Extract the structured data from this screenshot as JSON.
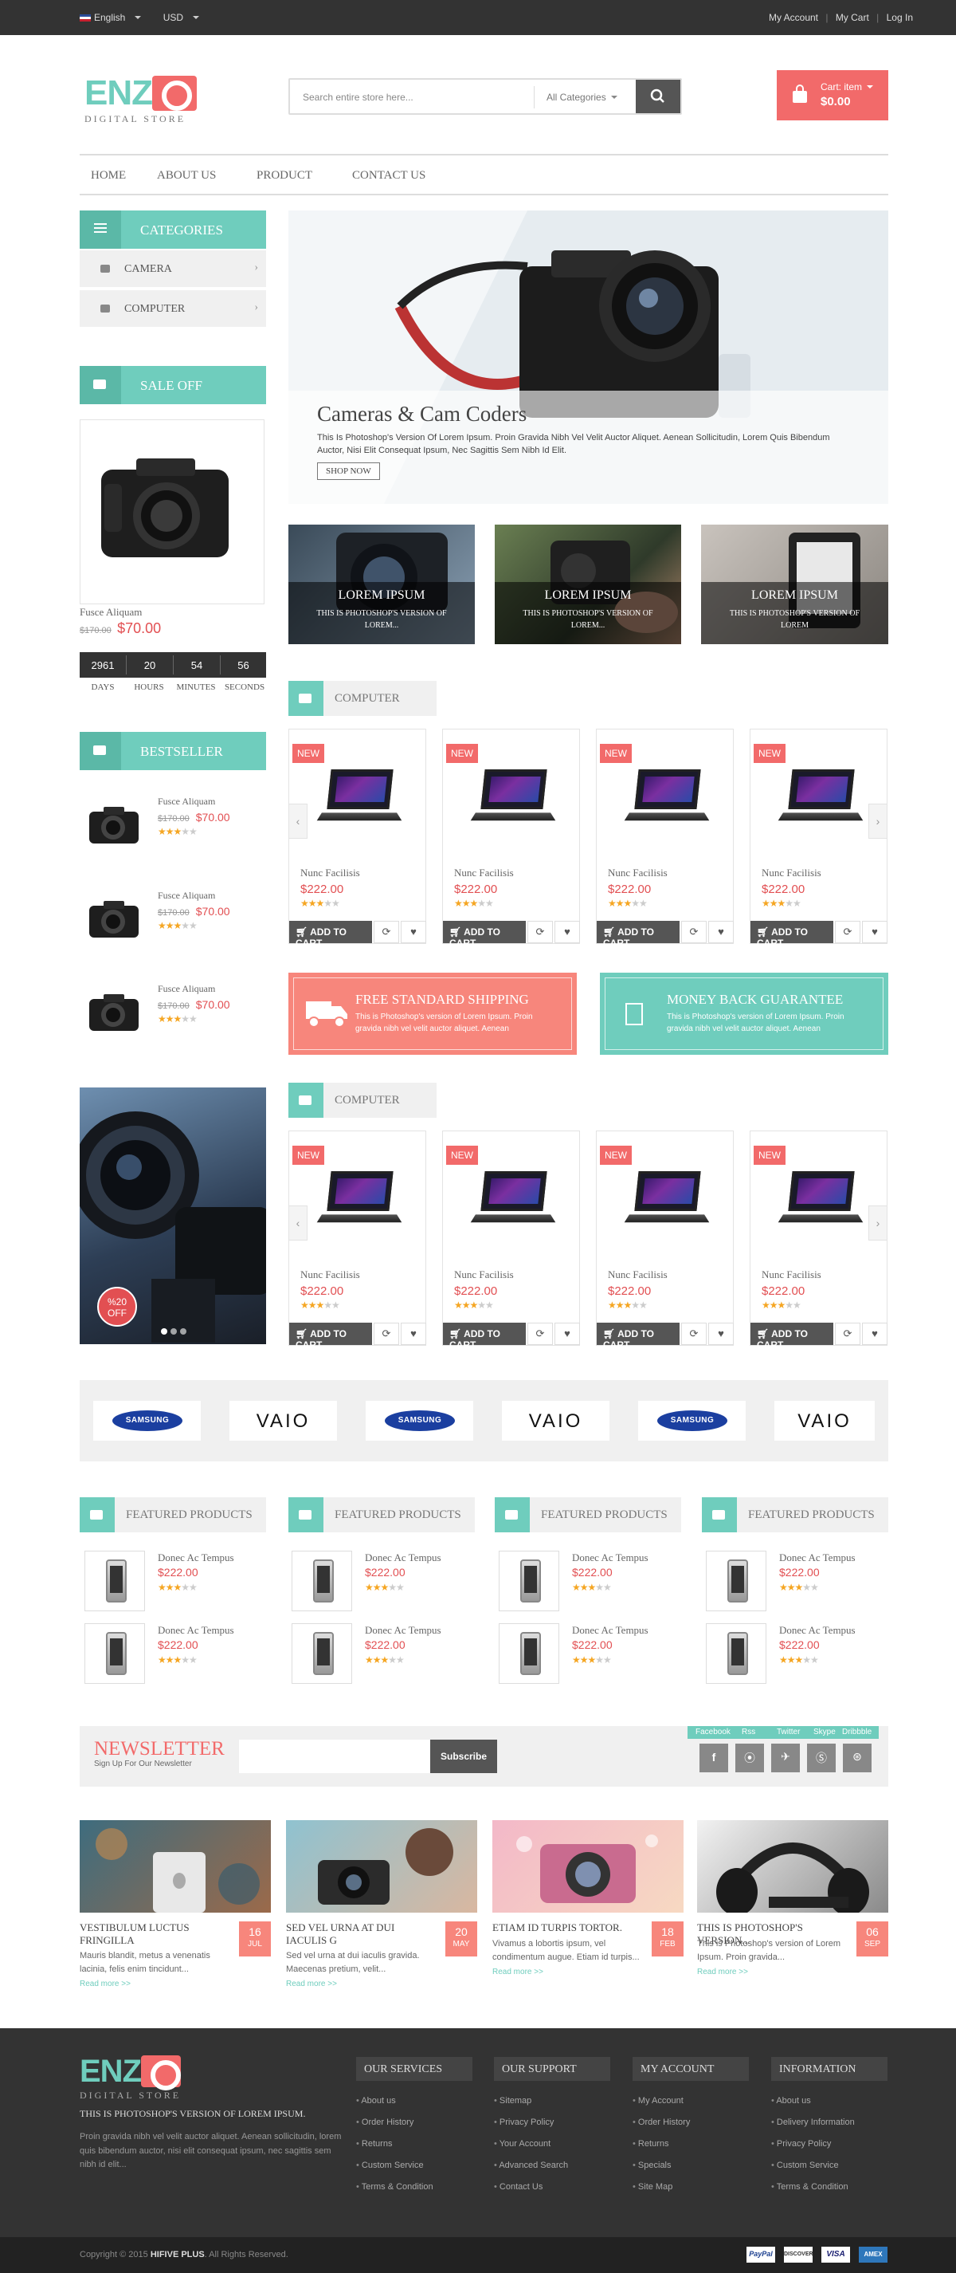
{
  "topbar": {
    "language": "English",
    "currency": "USD",
    "my_account": "My Account",
    "my_cart": "My Cart",
    "login": "Log In"
  },
  "header": {
    "logo_text": "ENZ",
    "logo_sub": "DIGITAL STORE",
    "search_placeholder": "Search entire store here...",
    "search_category": "All Categories",
    "cart_label": "Cart: item",
    "cart_total": "$0.00"
  },
  "menu": [
    "HOME",
    "ABOUT US",
    "PRODUCT",
    "CONTACT US"
  ],
  "sidebar": {
    "categories_title": "CATEGORIES",
    "categories": [
      "CAMERA",
      "COMPUTER"
    ],
    "sale_title": "SALE OFF",
    "sale_product": {
      "name": "Fusce Aliquam",
      "old_price": "$170.00",
      "price": "$70.00"
    },
    "countdown": {
      "values": [
        "2961",
        "20",
        "54",
        "56"
      ],
      "labels": [
        "DAYS",
        "HOURS",
        "MINUTES",
        "SECONDS"
      ]
    },
    "bestseller_title": "BESTSELLER",
    "bestsellers": [
      {
        "name": "Fusce Aliquam",
        "old_price": "$170.00",
        "price": "$70.00",
        "rating": 3
      },
      {
        "name": "Fusce Aliquam",
        "old_price": "$170.00",
        "price": "$70.00",
        "rating": 3
      },
      {
        "name": "Fusce Aliquam",
        "old_price": "$170.00",
        "price": "$70.00",
        "rating": 3
      }
    ],
    "promo_badge": "%20 OFF"
  },
  "hero": {
    "title": "Cameras & Cam Coders",
    "text": "This Is Photoshop's Version Of Lorem Ipsum. Proin Gravida Nibh Vel Velit Auctor Aliquet. Aenean Sollicitudin, Lorem Quis Bibendum Auctor, Nisi Elit Consequat Ipsum, Nec Sagittis Sem Nibh Id Elit.",
    "button": "SHOP NOW"
  },
  "banners": [
    {
      "title": "LOREM IPSUM",
      "text": "THIS IS PHOTOSHOP'S VERSION OF LOREM..."
    },
    {
      "title": "LOREM IPSUM",
      "text": "THIS IS PHOTOSHOP'S VERSION OF LOREM..."
    },
    {
      "title": "LOREM IPSUM",
      "text": "THIS IS PHOTOSHOP'S VERSION OF LOREM"
    }
  ],
  "product_sections": [
    {
      "title": "COMPUTER",
      "products": [
        {
          "badge": "NEW",
          "name": "Nunc Facilisis",
          "price": "$222.00",
          "rating": 3,
          "cta": "ADD TO CART"
        },
        {
          "badge": "NEW",
          "name": "Nunc Facilisis",
          "price": "$222.00",
          "rating": 3,
          "cta": "ADD TO CART"
        },
        {
          "badge": "NEW",
          "name": "Nunc Facilisis",
          "price": "$222.00",
          "rating": 3,
          "cta": "ADD TO CART"
        },
        {
          "badge": "NEW",
          "name": "Nunc Facilisis",
          "price": "$222.00",
          "rating": 3,
          "cta": "ADD TO CART"
        }
      ]
    },
    {
      "title": "COMPUTER",
      "products": [
        {
          "badge": "NEW",
          "name": "Nunc Facilisis",
          "price": "$222.00",
          "rating": 3,
          "cta": "ADD TO CART"
        },
        {
          "badge": "NEW",
          "name": "Nunc Facilisis",
          "price": "$222.00",
          "rating": 3,
          "cta": "ADD TO CART"
        },
        {
          "badge": "NEW",
          "name": "Nunc Facilisis",
          "price": "$222.00",
          "rating": 3,
          "cta": "ADD TO CART"
        },
        {
          "badge": "NEW",
          "name": "Nunc Facilisis",
          "price": "$222.00",
          "rating": 3,
          "cta": "ADD TO CART"
        }
      ]
    }
  ],
  "services": [
    {
      "title": "FREE STANDARD SHIPPING",
      "text": "This is Photoshop's version of Lorem Ipsum. Proin gravida nibh vel velit auctor aliquet. Aenean"
    },
    {
      "title": "MONEY BACK GUARANTEE",
      "text": "This is Photoshop's version of Lorem Ipsum. Proin gravida nibh vel velit auctor aliquet. Aenean"
    }
  ],
  "brands": [
    "SAMSUNG",
    "VAIO",
    "SAMSUNG",
    "VAIO",
    "SAMSUNG",
    "VAIO"
  ],
  "featured": {
    "title": "FEATURED PRODUCTS",
    "item": {
      "name": "Donec Ac Tempus",
      "price": "$222.00",
      "rating": 3
    }
  },
  "newsletter": {
    "title": "NEWSLETTER",
    "subtitle": "Sign Up For Our Newsletter",
    "button": "Subscribe",
    "social": [
      "Facebook",
      "Rss",
      "Twitter",
      "Skype",
      "Dribbble"
    ]
  },
  "blog": [
    {
      "title": "VESTIBULUM LUCTUS FRINGILLA",
      "text": "Mauris blandit, metus a venenatis lacinia, felis enim tincidunt...",
      "day": "16",
      "month": "JUL",
      "more": "Read more >>"
    },
    {
      "title": "SED VEL URNA AT DUI IACULIS G",
      "text": "Sed vel urna at dui iaculis gravida. Maecenas pretium, velit...",
      "day": "20",
      "month": "MAY",
      "more": "Read more >>"
    },
    {
      "title": "ETIAM ID TURPIS TORTOR.",
      "text": "Vivamus a lobortis ipsum, vel condimentum augue. Etiam id turpis...",
      "day": "18",
      "month": "FEB",
      "more": "Read more >>"
    },
    {
      "title": "THIS IS PHOTOSHOP'S VERSION...",
      "text": "This is Photoshop's version of Lorem Ipsum. Proin gravida...",
      "day": "06",
      "month": "SEP",
      "more": "Read more >>"
    }
  ],
  "footer": {
    "logo_text": "ENZ",
    "logo_sub": "DIGITAL STORE",
    "about_title": "THIS IS PHOTOSHOP'S VERSION OF LOREM IPSUM.",
    "about_text": "Proin gravida nibh vel velit auctor aliquet. Aenean sollicitudin, lorem quis bibendum auctor, nisi elit consequat ipsum, nec sagittis sem nibh id elit...",
    "columns": [
      {
        "title": "OUR SERVICES",
        "links": [
          "About us",
          "Order History",
          "Returns",
          "Custom Service",
          "Terms & Condition"
        ]
      },
      {
        "title": "OUR SUPPORT",
        "links": [
          "Sitemap",
          "Privacy Policy",
          "Your Account",
          "Advanced Search",
          "Contact Us"
        ]
      },
      {
        "title": "MY ACCOUNT",
        "links": [
          "My Account",
          "Order History",
          "Returns",
          "Specials",
          "Site Map"
        ]
      },
      {
        "title": "INFORMATION",
        "links": [
          "About us",
          "Delivery Information",
          "Privacy Policy",
          "Custom Service",
          "Terms & Condition"
        ]
      }
    ],
    "copyright_prefix": "Copyright © 2015",
    "copyright_brand": "HIFIVE PLUS",
    "copyright_suffix": ". All Rights Reserved.",
    "payments": [
      "PayPal",
      "DISCOVER",
      "VISA",
      "AMEX"
    ]
  },
  "colors": {
    "accent": "#6fcdbd",
    "brand_red": "#f26a6a",
    "price_red": "#e24f52",
    "dark": "#333333",
    "star": "#f5a623"
  }
}
